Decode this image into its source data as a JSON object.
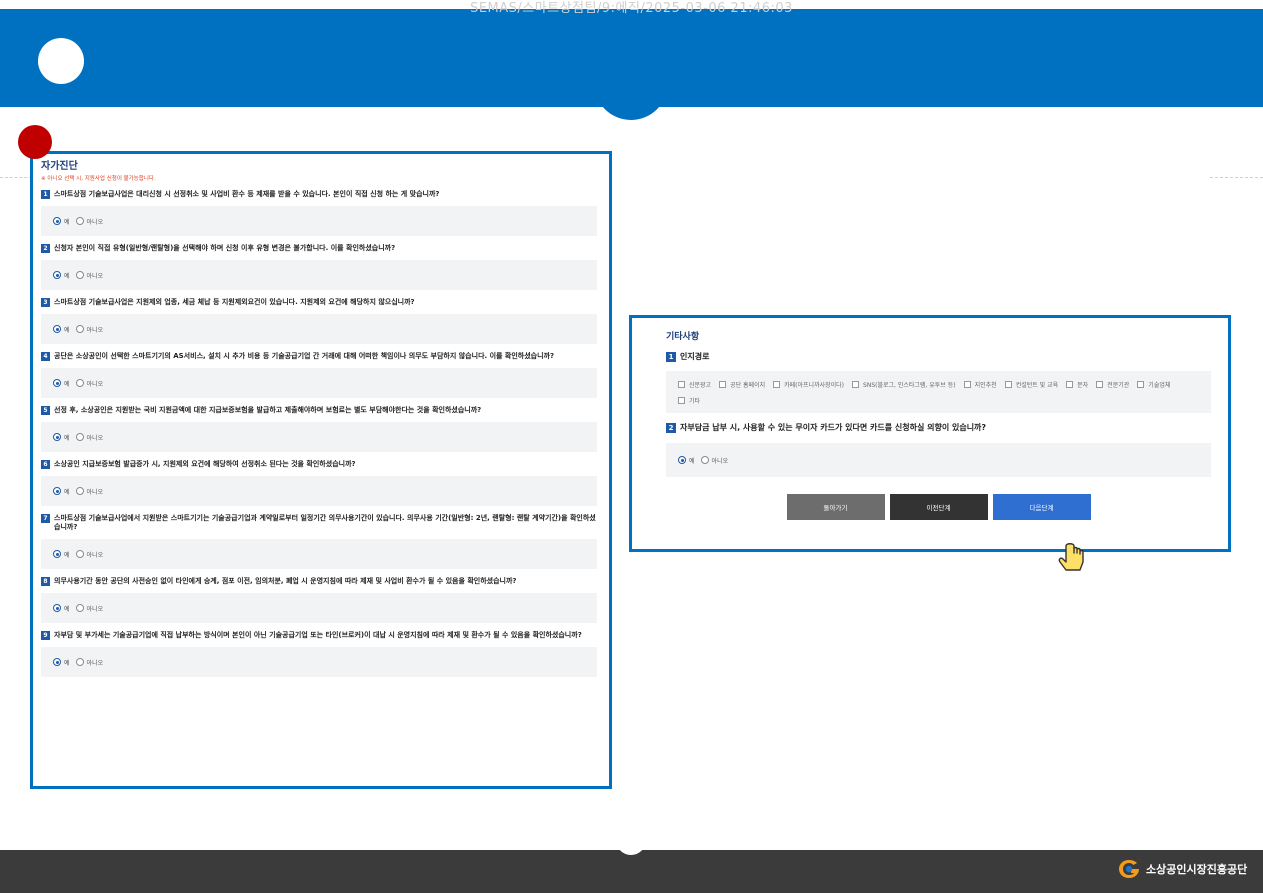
{
  "watermark": "SEMAS/스마트상점팀/9:에직/2025-03-06 21:46:03",
  "left_panel": {
    "title": "자가진단",
    "note": "※ 아니오 선택 시, 지원사업 신청이 불가능합니다.",
    "questions": [
      {
        "num": "1",
        "text": "스마트상점 기술보급사업은 대리신청 시 선정취소 및 사업비 환수 등 제재를 받을 수 있습니다. 본인이 직접 신청 하는 게 맞습니까?",
        "yes": "예",
        "no": "아니오"
      },
      {
        "num": "2",
        "text": "신청자 본인이 직접 유형(일반형/랜탈형)을 선택해야 하며 신청 이후 유형 변경은 불가합니다. 이를 확인하셨습니까?",
        "yes": "예",
        "no": "아니오"
      },
      {
        "num": "3",
        "text": "스마트상점 기술보급사업은 지원제외 업종, 세금 체납 등 지원제외요건이 있습니다. 지원제외 요건에 해당하지 않으십니까?",
        "yes": "예",
        "no": "아니오"
      },
      {
        "num": "4",
        "text": "공단은 소상공인이 선택한 스마트기기의 AS서비스, 설치 시 추가 비용 등 기술공급기업 간 거래에 대해 어떠한 책임이나 의무도 부담하지 않습니다. 이를 확인하셨습니까?",
        "yes": "예",
        "no": "아니오"
      },
      {
        "num": "5",
        "text": "선정 후, 소상공인은 지원받는 국비 지원금액에 대한 지급보증보험을 발급하고 제출해야하며 보험료는 별도 부담해야한다는 것을 확인하셨습니까?",
        "yes": "예",
        "no": "아니오"
      },
      {
        "num": "6",
        "text": "소상공인 지급보증보험 발급증가 시, 지원제외 요건에 해당하여 선정취소 된다는 것을 확인하셨습니까?",
        "yes": "예",
        "no": "아니오"
      },
      {
        "num": "7",
        "text": "스마트상점 기술보급사업에서 지원받은 스마트기기는 기술공급기업과 계약일로부터 일정기간 의무사용기간이 있습니다. 의무사용 기간(일반형: 2년, 랜탈형: 랜탈 계약기간)을 확인하셨습니까?",
        "yes": "예",
        "no": "아니오"
      },
      {
        "num": "8",
        "text": "의무사용기간 동안 공단의 사전승인 없이 타인에게 승계, 점포 이전, 임의처분, 폐업 시 운영지침에 따라 제재 및 사업비 환수가 될 수 있음을 확인하셨습니까?",
        "yes": "예",
        "no": "아니오"
      },
      {
        "num": "9",
        "text": "자부담 및 부가세는 기술공급기업에 직접 납부하는 방식이며 본인이 아닌 기술공급기업 또는 타인(브로커)이 대납 시 운영지침에 따라 제재 및 환수가 될 수 있음을 확인하셨습니까?",
        "yes": "예",
        "no": "아니오"
      }
    ]
  },
  "right_panel": {
    "title": "기타사항",
    "q1": {
      "num": "1",
      "text": "인지경로"
    },
    "channels": [
      "신문광고",
      "공단 홈페이지",
      "카페(아프니까사장이다)",
      "SNS(블로그, 인스타그램, 유투브 등)",
      "지인추천",
      "컨설턴트 및 교육",
      "문자",
      "전문기관",
      "기술업체",
      "기타"
    ],
    "q2": {
      "num": "2",
      "text": "자부담금 납부 시, 사용할 수 있는 무이자 카드가 있다면 카드를 신청하실 의향이 있습니까?",
      "yes": "예",
      "no": "아니오"
    },
    "buttons": {
      "back": "돌아가기",
      "prev": "이전단계",
      "next": "다음단계"
    }
  },
  "footer": {
    "org_name": "소상공인시장진흥공단"
  },
  "icons": {
    "cursor": "hand-pointer-icon",
    "logo": "semas-logo-icon"
  },
  "colors": {
    "brand_blue": "#0071c1",
    "panel_border": "#0070c0",
    "marker_red": "#c00000",
    "footer": "#3b3b3b"
  }
}
